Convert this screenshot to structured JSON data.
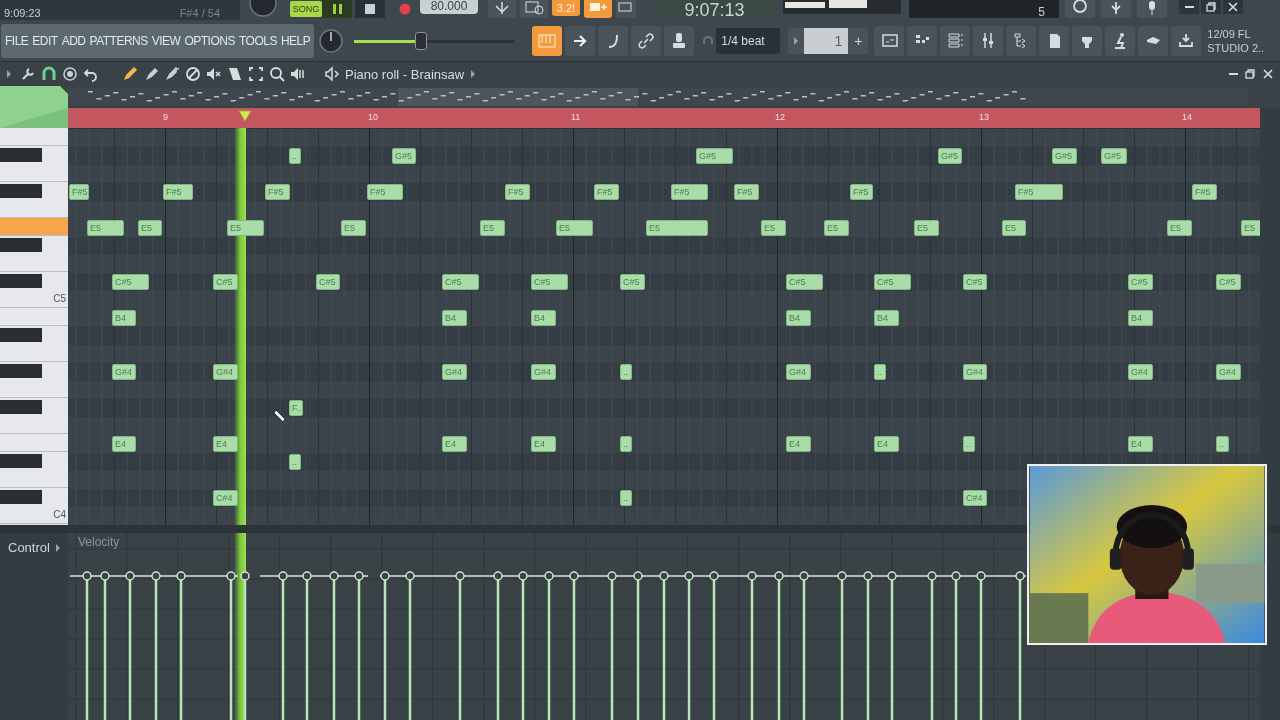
{
  "transport": {
    "clock": "9:09:23",
    "hint": "F#4 / 54",
    "song_button": {
      "label": "SONG",
      "on": true
    },
    "tempo": "80.000",
    "pattern": "3.2!",
    "song_time": "9:07:13",
    "polyphony": "5"
  },
  "menu": [
    "FILE",
    "EDIT",
    "ADD",
    "PATTERNS",
    "VIEW",
    "OPTIONS",
    "TOOLS",
    "HELP"
  ],
  "master_volume": {
    "level": 0.42
  },
  "snap": {
    "value": "1/4 beat"
  },
  "pattern_selector": {
    "value": "1",
    "add": "+"
  },
  "hint_panel": {
    "lines": [
      "12/09 FL",
      "STUDIO 2.."
    ]
  },
  "piano_roll": {
    "title": "Piano roll - Brainsaw",
    "bars": [
      "9",
      "10",
      "11",
      "12",
      "13",
      "14"
    ],
    "keys": [
      {
        "kind": "white",
        "highlighted": false
      },
      {
        "kind": "black",
        "highlighted": false
      },
      {
        "kind": "white",
        "highlighted": false
      },
      {
        "kind": "black",
        "highlighted": false
      },
      {
        "kind": "white",
        "highlighted": false
      },
      {
        "kind": "white",
        "highlighted": true
      },
      {
        "kind": "black",
        "highlighted": false
      },
      {
        "kind": "white",
        "highlighted": false
      },
      {
        "kind": "black",
        "highlighted": false
      },
      {
        "kind": "white",
        "highlighted": false,
        "label": "C5"
      },
      {
        "kind": "white",
        "highlighted": false
      },
      {
        "kind": "black",
        "highlighted": false
      },
      {
        "kind": "white",
        "highlighted": false
      },
      {
        "kind": "black",
        "highlighted": false
      },
      {
        "kind": "white",
        "highlighted": false
      },
      {
        "kind": "black",
        "highlighted": false
      },
      {
        "kind": "white",
        "highlighted": false
      },
      {
        "kind": "white",
        "highlighted": false
      },
      {
        "kind": "black",
        "highlighted": false
      },
      {
        "kind": "white",
        "highlighted": false
      },
      {
        "kind": "black",
        "highlighted": false
      },
      {
        "kind": "white",
        "highlighted": false,
        "label": "C4"
      }
    ],
    "notes": [
      {
        "label": ".."
      },
      {
        "label": "G#5"
      },
      {
        "label": "G#5"
      },
      {
        "label": "G#5"
      },
      {
        "label": "G#5"
      },
      {
        "label": "G#5"
      },
      {
        "label": "F#5"
      },
      {
        "label": "F#5"
      },
      {
        "label": "F#5"
      },
      {
        "label": "F#5"
      },
      {
        "label": "F#5"
      },
      {
        "label": "F#5"
      },
      {
        "label": "F#5"
      },
      {
        "label": "F#5"
      },
      {
        "label": "F#5"
      },
      {
        "label": "F#5"
      },
      {
        "label": "F#5"
      },
      {
        "label": "E5"
      },
      {
        "label": "E5"
      },
      {
        "label": "E5"
      },
      {
        "label": "E5"
      },
      {
        "label": "E5"
      },
      {
        "label": "E5"
      },
      {
        "label": "E5"
      },
      {
        "label": "E5"
      },
      {
        "label": "E5"
      },
      {
        "label": "E5"
      },
      {
        "label": "E5"
      },
      {
        "label": "E5"
      },
      {
        "label": "E5"
      },
      {
        "label": "C#5"
      },
      {
        "label": "C#5"
      },
      {
        "label": "C#5"
      },
      {
        "label": "C#5"
      },
      {
        "label": "C#5"
      },
      {
        "label": "C#5"
      },
      {
        "label": "C#5"
      },
      {
        "label": "C#5"
      },
      {
        "label": "C#5"
      },
      {
        "label": "C#5"
      },
      {
        "label": "C#5"
      },
      {
        "label": "B4"
      },
      {
        "label": "B4"
      },
      {
        "label": "B4"
      },
      {
        "label": "B4"
      },
      {
        "label": "B4"
      },
      {
        "label": "B4"
      },
      {
        "label": "G#4"
      },
      {
        "label": "G#4"
      },
      {
        "label": "G#4"
      },
      {
        "label": "G#4"
      },
      {
        "label": ".."
      },
      {
        "label": "G#4"
      },
      {
        "label": ".."
      },
      {
        "label": "G#4"
      },
      {
        "label": "G#4"
      },
      {
        "label": "G#4"
      },
      {
        "label": "F.."
      },
      {
        "label": "E4"
      },
      {
        "label": "E4"
      },
      {
        "label": "E4"
      },
      {
        "label": "E4"
      },
      {
        "label": ".."
      },
      {
        "label": "E4"
      },
      {
        "label": "E4"
      },
      {
        "label": ".."
      },
      {
        "label": "E4"
      },
      {
        "label": ".."
      },
      {
        "label": ".."
      },
      {
        "label": "C#4"
      },
      {
        "label": ".."
      },
      {
        "label": "C#4"
      }
    ],
    "control": {
      "label": "Control",
      "lane": "Velocity"
    }
  }
}
